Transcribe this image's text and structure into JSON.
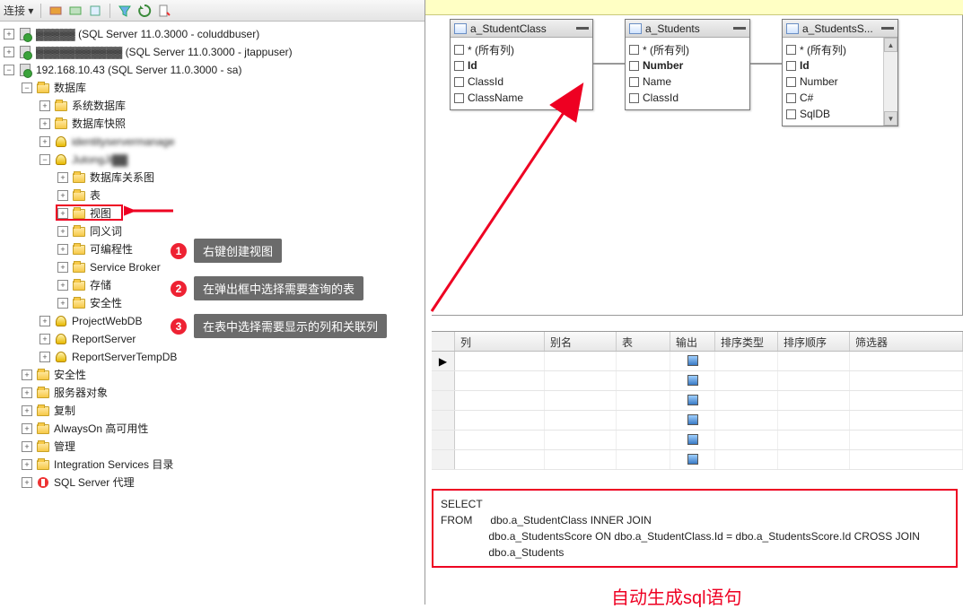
{
  "toolbar": {
    "label": "连接 ▾"
  },
  "tree": {
    "srv1": "(SQL Server 11.0.3000 - coluddbuser)",
    "srv2": "(SQL Server 11.0.3000 - jtappuser)",
    "srv3": "192.168.10.43 (SQL Server 11.0.3000 - sa)",
    "db_root": "数据库",
    "sys_db": "系统数据库",
    "db_snap": "数据库快照",
    "db_mask1": "IdentityServermanage",
    "db_mask2": "JutongJi",
    "diagram": "数据库关系图",
    "table": "表",
    "view": "视图",
    "synonym": "同义词",
    "programmability": "可编程性",
    "servicebroker": "Service Broker",
    "storage": "存储",
    "security_db": "安全性",
    "projectwebdb": "ProjectWebDB",
    "reportserver": "ReportServer",
    "reportservertempdb": "ReportServerTempDB",
    "security": "安全性",
    "server_objects": "服务器对象",
    "replication": "复制",
    "alwayson": "AlwaysOn 高可用性",
    "management": "管理",
    "integration": "Integration Services 目录",
    "sqlagent": "SQL Server 代理"
  },
  "callouts": {
    "c1": "右键创建视图",
    "c2": "在弹出框中选择需要查询的表",
    "c3": "在表中选择需要显示的列和关联列"
  },
  "tables": {
    "t1": {
      "title": "a_StudentClass",
      "rows": [
        "* (所有列)",
        "Id",
        "ClassId",
        "ClassName"
      ],
      "bold": [
        false,
        true,
        false,
        false
      ]
    },
    "t2": {
      "title": "a_Students",
      "rows": [
        "* (所有列)",
        "Number",
        "Name",
        "ClassId"
      ],
      "bold": [
        false,
        true,
        false,
        false
      ]
    },
    "t3": {
      "title": "a_StudentsS...",
      "rows": [
        "* (所有列)",
        "Id",
        "Number",
        "C#",
        "SqlDB"
      ],
      "bold": [
        false,
        true,
        false,
        false,
        false
      ]
    }
  },
  "grid": {
    "cols": [
      "列",
      "别名",
      "表",
      "输出",
      "排序类型",
      "排序顺序",
      "筛选器"
    ]
  },
  "sql": {
    "l1": "SELECT",
    "l2": "FROM      dbo.a_StudentClass INNER JOIN",
    "l3": "                dbo.a_StudentsScore ON dbo.a_StudentClass.Id = dbo.a_StudentsScore.Id CROSS JOIN",
    "l4": "                dbo.a_Students"
  },
  "auto_label": "自动生成sql语句"
}
